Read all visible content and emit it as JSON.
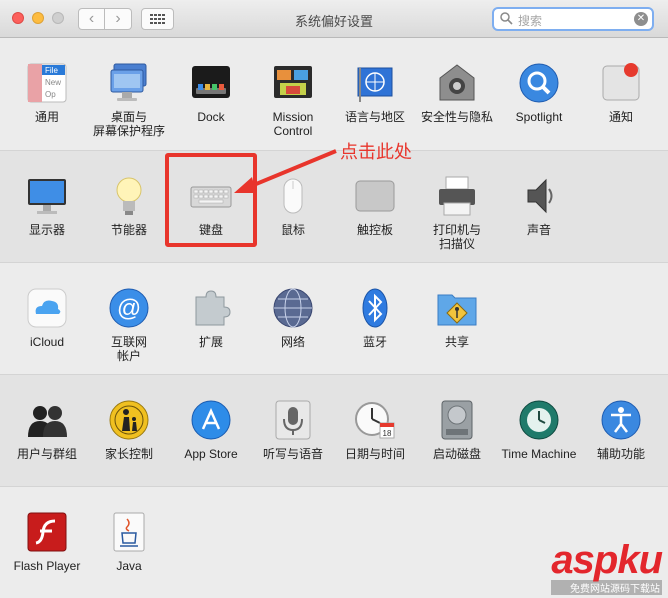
{
  "window": {
    "title": "系统偏好设置"
  },
  "search": {
    "placeholder": "搜索"
  },
  "sections": [
    [
      {
        "name": "general-icon",
        "label": "通用",
        "line2": ""
      },
      {
        "name": "desktop-screensaver-icon",
        "label": "桌面与",
        "line2": "屏幕保护程序"
      },
      {
        "name": "dock-icon",
        "label": "Dock",
        "line2": ""
      },
      {
        "name": "mission-control-icon",
        "label": "Mission",
        "line2": "Control"
      },
      {
        "name": "language-region-icon",
        "label": "语言与地区",
        "line2": ""
      },
      {
        "name": "security-privacy-icon",
        "label": "安全性与隐私",
        "line2": ""
      },
      {
        "name": "spotlight-icon",
        "label": "Spotlight",
        "line2": ""
      },
      {
        "name": "notifications-icon",
        "label": "通知",
        "line2": ""
      }
    ],
    [
      {
        "name": "displays-icon",
        "label": "显示器",
        "line2": ""
      },
      {
        "name": "energy-saver-icon",
        "label": "节能器",
        "line2": ""
      },
      {
        "name": "keyboard-icon",
        "label": "键盘",
        "line2": ""
      },
      {
        "name": "mouse-icon",
        "label": "鼠标",
        "line2": ""
      },
      {
        "name": "trackpad-icon",
        "label": "触控板",
        "line2": ""
      },
      {
        "name": "printers-scanners-icon",
        "label": "打印机与",
        "line2": "扫描仪"
      },
      {
        "name": "sound-icon",
        "label": "声音",
        "line2": ""
      }
    ],
    [
      {
        "name": "icloud-icon",
        "label": "iCloud",
        "line2": ""
      },
      {
        "name": "internet-accounts-icon",
        "label": "互联网",
        "line2": "帐户"
      },
      {
        "name": "extensions-icon",
        "label": "扩展",
        "line2": ""
      },
      {
        "name": "network-icon",
        "label": "网络",
        "line2": ""
      },
      {
        "name": "bluetooth-icon",
        "label": "蓝牙",
        "line2": ""
      },
      {
        "name": "sharing-icon",
        "label": "共享",
        "line2": ""
      }
    ],
    [
      {
        "name": "users-groups-icon",
        "label": "用户与群组",
        "line2": ""
      },
      {
        "name": "parental-controls-icon",
        "label": "家长控制",
        "line2": ""
      },
      {
        "name": "app-store-icon",
        "label": "App Store",
        "line2": ""
      },
      {
        "name": "dictation-speech-icon",
        "label": "听写与语音",
        "line2": ""
      },
      {
        "name": "date-time-icon",
        "label": "日期与时间",
        "line2": ""
      },
      {
        "name": "startup-disk-icon",
        "label": "启动磁盘",
        "line2": ""
      },
      {
        "name": "time-machine-icon",
        "label": "Time Machine",
        "line2": ""
      },
      {
        "name": "accessibility-icon",
        "label": "辅助功能",
        "line2": ""
      }
    ],
    [
      {
        "name": "flash-player-icon",
        "label": "Flash Player",
        "line2": ""
      },
      {
        "name": "java-icon",
        "label": "Java",
        "line2": ""
      }
    ]
  ],
  "general_icon_text": [
    "File",
    "New",
    "Op"
  ],
  "calendar_icon_text": "18",
  "annotation": {
    "text": "点击此处"
  },
  "watermark": {
    "main": "aspku",
    "sub": "免费网站源码下载站"
  },
  "colors": {
    "annotation_red": "#e8352c",
    "search_focus": "#7eaef0"
  }
}
